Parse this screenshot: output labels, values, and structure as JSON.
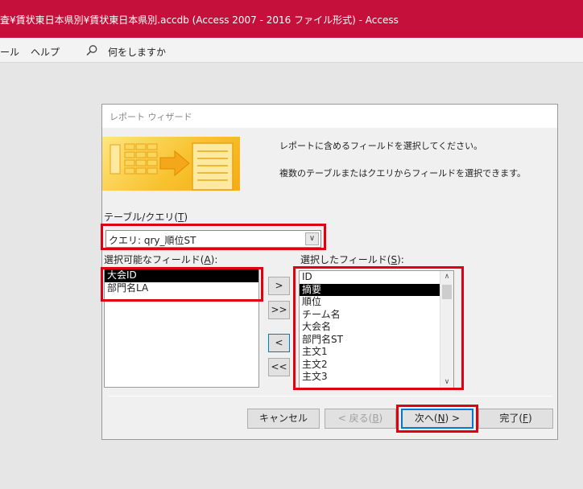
{
  "app": {
    "title": "査¥賃状東日本県別¥賃状東日本県別.accdb (Access 2007 - 2016 ファイル形式)  -  Access"
  },
  "menubar": {
    "items": [
      "ール",
      "ヘルプ"
    ],
    "search_text": "何をしますか"
  },
  "dialog": {
    "title": "レポート ウィザード",
    "instruction_1": "レポートに含めるフィールドを選択してください。",
    "instruction_2": "複数のテーブルまたはクエリからフィールドを選択できます。",
    "table_query_label": "テーブル/クエリ(",
    "table_query_key": "T",
    "table_query_value": "クエリ: qry_順位ST",
    "available_label": "選択可能なフィールド(",
    "available_key": "A",
    "available_fields": [
      "大会ID",
      "部門名LA"
    ],
    "available_selected_index": 0,
    "selected_label": "選択したフィールド(",
    "selected_key": "S",
    "selected_fields": [
      "ID",
      "摘要",
      "順位",
      "チーム名",
      "大会名",
      "部門名ST",
      "主文1",
      "主文2",
      "主文3"
    ],
    "selected_selected_index": 1,
    "move_buttons": [
      ">",
      ">>",
      "<",
      "<<"
    ],
    "buttons": {
      "cancel": "キャンセル",
      "back_pre": "< 戻る(",
      "back_key": "B",
      "next_pre": "次へ(",
      "next_key": "N",
      "next_post": ") >",
      "finish_pre": "完了(",
      "finish_key": "F"
    }
  },
  "colors": {
    "titlebar": "#c4103a",
    "highlight": "#e0000f",
    "focus": "#0078d7"
  }
}
